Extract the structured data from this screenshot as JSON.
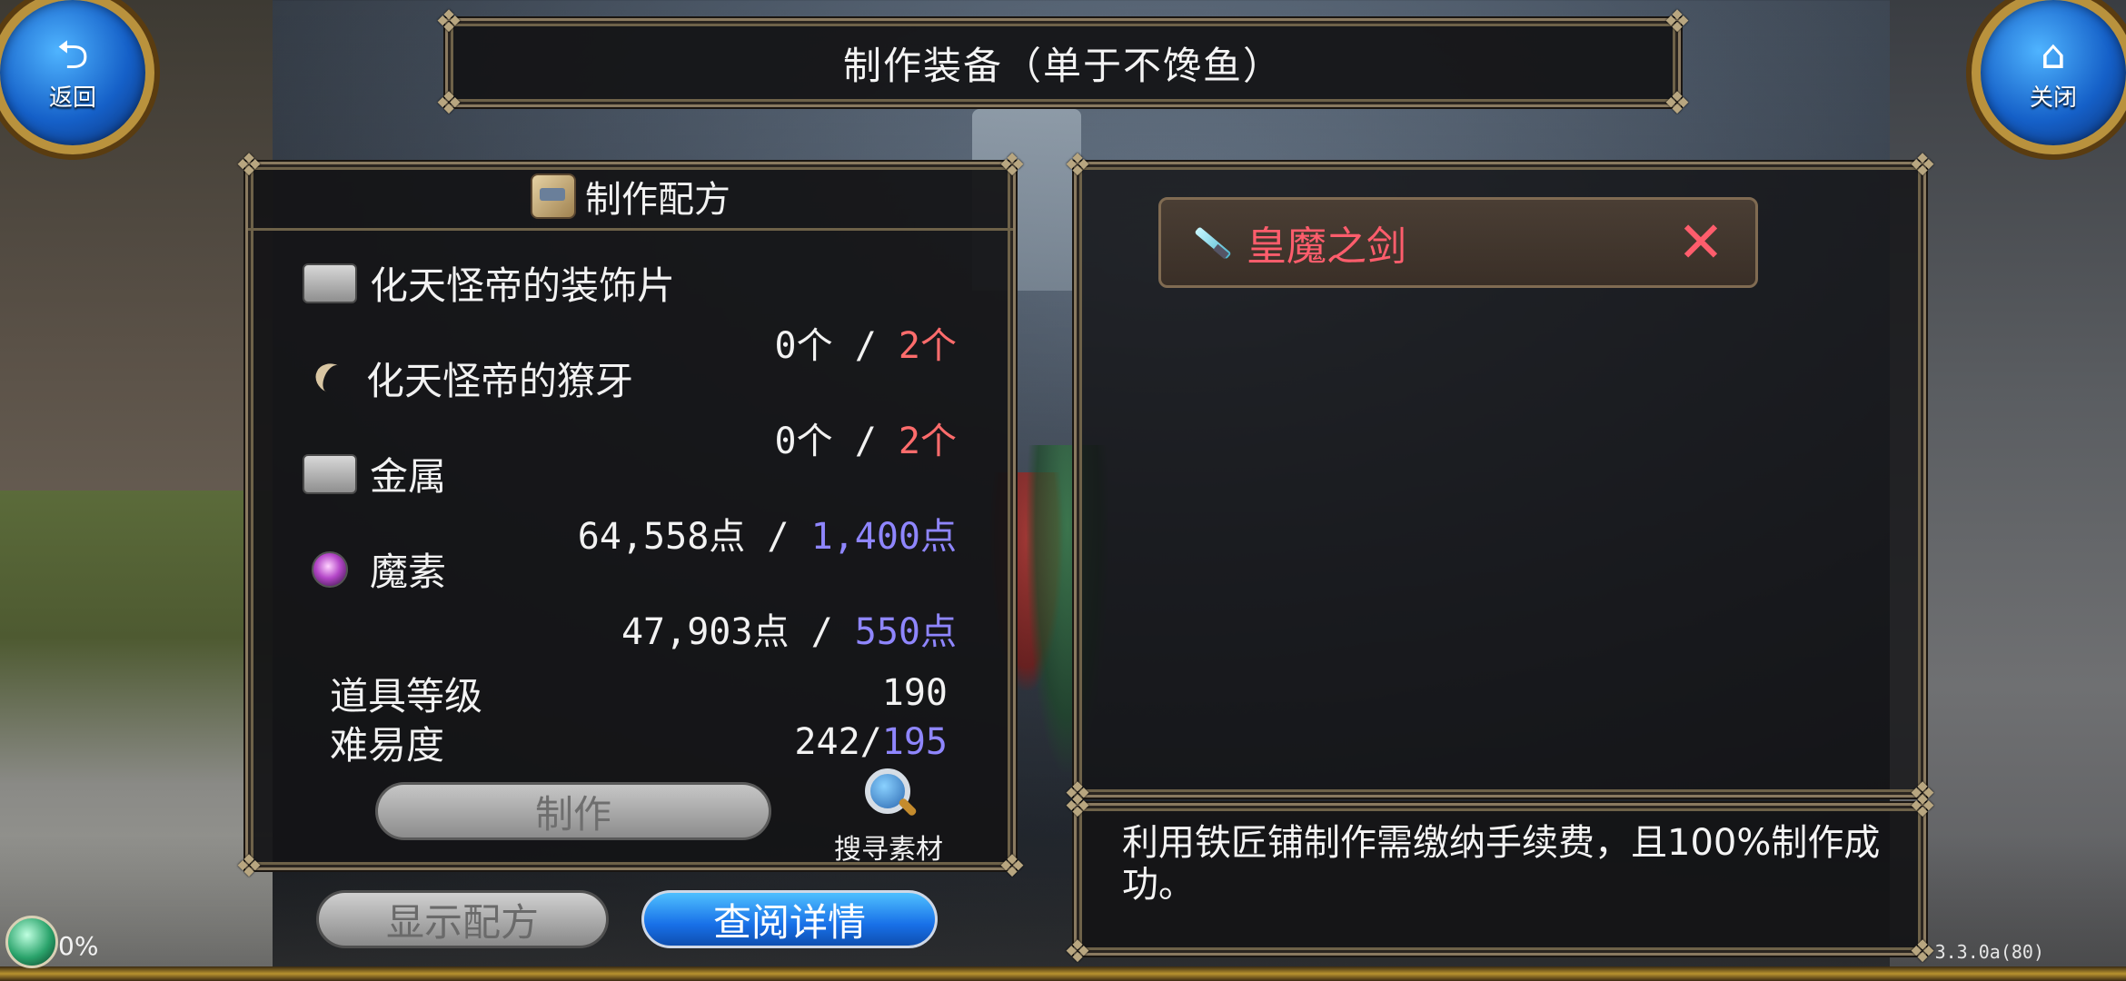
{
  "title": "制作装备（单于不馋鱼）",
  "nav": {
    "back_label": "返回",
    "close_label": "关闭"
  },
  "recipe": {
    "header": "制作配方",
    "materials": [
      {
        "name": "化天怪帝的装饰片",
        "have": "0个",
        "sep": "/",
        "need": "2个",
        "icon": "plate-icon",
        "need_color": "#ff6c6c"
      },
      {
        "name": "化天怪帝的獠牙",
        "have": "0个",
        "sep": "/",
        "need": "2个",
        "icon": "fang-icon",
        "need_color": "#ff6c6c"
      },
      {
        "name": "金属",
        "have": "64,558点",
        "sep": "/",
        "need": "1,400点",
        "icon": "metal-plate-icon",
        "need_color": "#8f86ff"
      },
      {
        "name": "魔素",
        "have": "47,903点",
        "sep": "/",
        "need": "550点",
        "icon": "mana-orb-icon",
        "need_color": "#8f86ff"
      }
    ],
    "item_level_label": "道具等级",
    "item_level_value": "190",
    "difficulty_label": "难易度",
    "difficulty_current": "242/",
    "difficulty_target": "195",
    "craft_button": "制作",
    "search_label": "搜寻素材"
  },
  "buttons": {
    "show_recipe": "显示配方",
    "view_details": "查阅详情"
  },
  "preview": {
    "item_name": "皇魔之剑",
    "remove_icon": "✕"
  },
  "info": {
    "text": "利用铁匠铺制作需缴纳手续费，且100%制作成功。"
  },
  "status": {
    "progress": "0%",
    "version": "3.3.0a(80)"
  }
}
